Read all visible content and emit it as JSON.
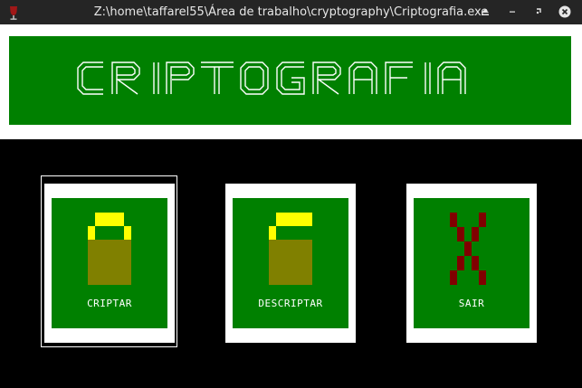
{
  "window": {
    "title": "Z:\\home\\taffarel55\\Área de trabalho\\cryptography\\Criptografia.exe",
    "app_icon": "wine-glass-icon",
    "controls": [
      "minimize-icon",
      "restore-icon",
      "close-icon"
    ]
  },
  "banner": {
    "title": "CRIPTOGRAFIA"
  },
  "menu": {
    "items": [
      {
        "label": "CRIPTAR",
        "icon": "lock-closed-icon"
      },
      {
        "label": "DESCRIPTAR",
        "icon": "lock-open-icon"
      },
      {
        "label": "SAIR",
        "icon": "exit-x-icon"
      }
    ]
  },
  "colors": {
    "background": "#000000",
    "panel": "#ffffff",
    "accent_green": "#008000",
    "lock_body": "#808000",
    "lock_shackle": "#ffff00",
    "exit_red": "#800000",
    "titlebar": "#252525"
  }
}
